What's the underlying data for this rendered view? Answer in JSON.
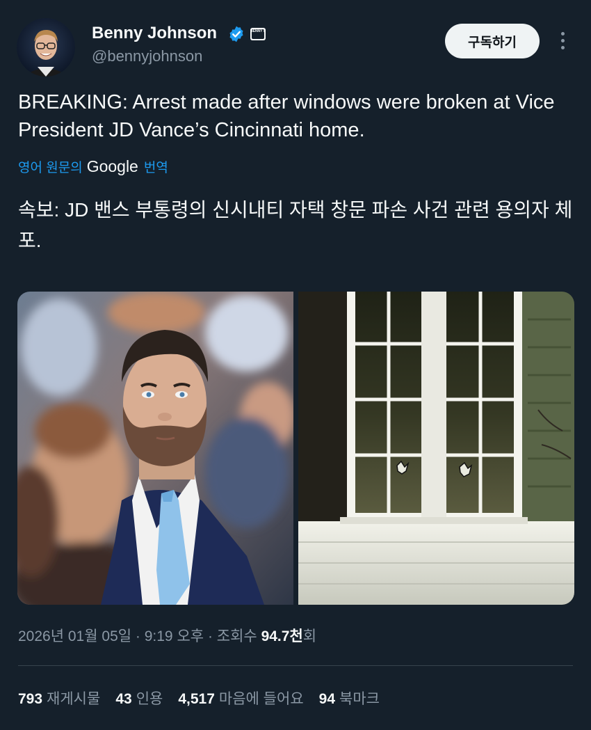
{
  "author": {
    "display_name": "Benny Johnson",
    "handle": "@bennyjohnson",
    "verified": true,
    "affiliate_badge_text": "BENNY SHOW"
  },
  "actions": {
    "subscribe_label": "구독하기",
    "more_icon": "more-vertical-icon"
  },
  "tweet": {
    "text": "BREAKING: Arrest made after windows were broken at Vice President JD Vance’s Cincinnati home.",
    "translate_prefix": "영어 원문의",
    "translate_brand": "Google",
    "translate_suffix": "번역",
    "translated_text": "속보: JD 밴스 부통령의 신시내티 자택 창문 파손 사건 관련 용의자 체포."
  },
  "media": {
    "photos": [
      {
        "description": "man in suit with light blue tie in crowd"
      },
      {
        "description": "white-framed windows with bullet holes at night"
      }
    ]
  },
  "meta": {
    "date": "2026년 01월 05일",
    "time": "9:19 오후",
    "views_label": "조회수",
    "views_number": "94.7천",
    "views_suffix": "회"
  },
  "stats": {
    "reposts": {
      "value": "793",
      "label": "재게시물"
    },
    "quotes": {
      "value": "43",
      "label": "인용"
    },
    "likes": {
      "value": "4,517",
      "label": "마음에 들어요"
    },
    "bookmarks": {
      "value": "94",
      "label": "북마크"
    }
  },
  "colors": {
    "background": "#15202b",
    "text_primary": "#f7f9f9",
    "text_secondary": "#8b98a5",
    "accent": "#1d9bf0",
    "divider": "#38444d"
  }
}
